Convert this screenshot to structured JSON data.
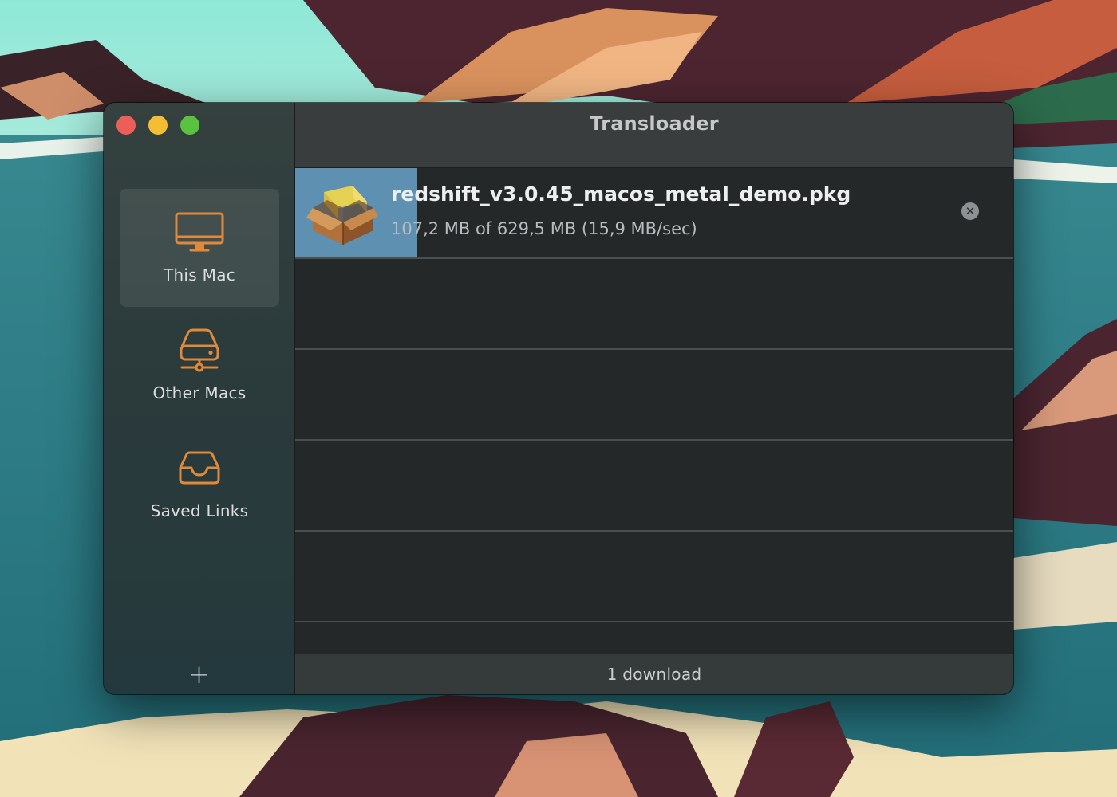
{
  "window": {
    "title": "Transloader"
  },
  "sidebar": {
    "items": [
      {
        "label": "This Mac",
        "icon": "desktop-computer-icon",
        "selected": true
      },
      {
        "label": "Other Macs",
        "icon": "network-drive-icon",
        "selected": false
      },
      {
        "label": "Saved Links",
        "icon": "inbox-tray-icon",
        "selected": false
      }
    ],
    "add_label": "+"
  },
  "downloads": [
    {
      "filename": "redshift_v3.0.45_macos_metal_demo.pkg",
      "status": "107,2 MB of 629,5 MB (15,9 MB/sec)",
      "progress": 0.17,
      "icon": "package-box-icon"
    }
  ],
  "footer": {
    "status": "1 download"
  },
  "colors": {
    "accent": "#e0893a",
    "progress": "#5d90b1",
    "close": "#ec5f58",
    "minimize": "#f3be33",
    "maximize": "#5ac23e"
  }
}
